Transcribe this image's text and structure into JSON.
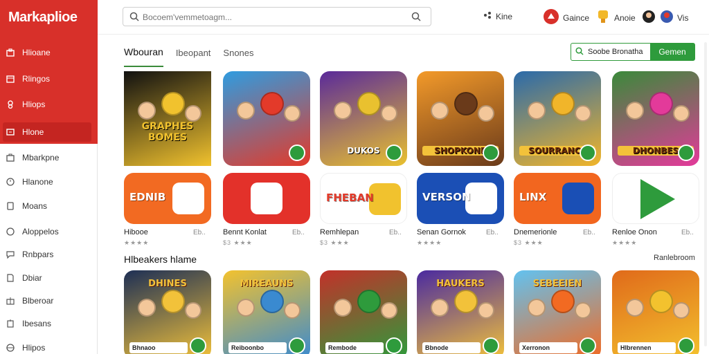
{
  "app": {
    "brand": "Markaplioe"
  },
  "sidebar": {
    "items": [
      {
        "label": "Hlioane",
        "icon": "store-icon"
      },
      {
        "label": "Rlingos",
        "icon": "bag-icon"
      },
      {
        "label": "Hliops",
        "icon": "tag-icon"
      },
      {
        "label": "Hlone",
        "icon": "home-icon"
      },
      {
        "label": "Mbarkpne",
        "icon": "briefcase-icon"
      },
      {
        "label": "Hlanone",
        "icon": "clock-icon"
      },
      {
        "label": "Moans",
        "icon": "tablet-icon"
      },
      {
        "label": "Aloppelos",
        "icon": "circle-icon"
      },
      {
        "label": "Rnbpars",
        "icon": "chat-icon"
      },
      {
        "label": "Dbiar",
        "icon": "doc-icon"
      },
      {
        "label": "Blberoar",
        "icon": "gift-icon"
      },
      {
        "label": "Ibesans",
        "icon": "list-icon"
      },
      {
        "label": "Hlipos",
        "icon": "globe-icon"
      }
    ]
  },
  "topbar": {
    "search_placeholder": "Bocoem'vemmetoagm...",
    "links": [
      {
        "label": "Kine",
        "icon": "share-icon"
      },
      {
        "label": "Gaince",
        "icon": "game-icon"
      },
      {
        "label": "Anoie",
        "icon": "trophy-icon"
      },
      {
        "label": "Vis",
        "icon": "avatar-icon"
      }
    ]
  },
  "tabs": [
    {
      "label": "Wbouran"
    },
    {
      "label": "Ibeopant"
    },
    {
      "label": "Snones"
    }
  ],
  "filter": {
    "label": "Soobe Bronatha",
    "action": "Gemen"
  },
  "row1": [
    {
      "title": "GRAPHES BOMES",
      "name": "Hibooe",
      "value": "Eb..",
      "stars": "★★★★",
      "colors": [
        "#111111",
        "#f1c22e"
      ]
    },
    {
      "title": "",
      "name": "Bennt Konlat",
      "value": "Eb..",
      "stars": "$3 ★★★",
      "colors": [
        "#2f9ce0",
        "#e33a2a"
      ]
    },
    {
      "title": "DUKOS",
      "name": "Remhlepan",
      "value": "Eb..",
      "stars": "$3 ★★★",
      "colors": [
        "#5a2a9a",
        "#e9c12f"
      ]
    },
    {
      "title": "SHOPKONB",
      "name": "Senan Gornok",
      "value": "Eb..",
      "stars": "★★★★",
      "colors": [
        "#f39a2a",
        "#6a3a1a"
      ]
    },
    {
      "title": "SOURRANCE",
      "name": "Dnemerionle",
      "value": "Eb..",
      "stars": "$3 ★★★",
      "colors": [
        "#2a6aaa",
        "#f1b52a"
      ]
    },
    {
      "title": "DHONBES",
      "name": "Renloe Onon",
      "value": "Eb..",
      "stars": "★★★★",
      "colors": [
        "#3a8a3a",
        "#e33a9a"
      ]
    }
  ],
  "row2": [
    {
      "title": "EDNIB",
      "icon": "gamepad-icon",
      "colors": [
        "#f26a22",
        "#ffffff"
      ]
    },
    {
      "title": "",
      "icon": "gamepad-icon",
      "colors": [
        "#e3312a",
        "#ffffff"
      ]
    },
    {
      "title": "FHEBAN",
      "icon": "bubble-icon",
      "colors": [
        "#ffffff",
        "#f1c22e"
      ]
    },
    {
      "title": "VERSON",
      "icon": "ring-icon",
      "colors": [
        "#1b4fb5",
        "#ffffff"
      ]
    },
    {
      "title": "LINX",
      "icon": "box-icon",
      "colors": [
        "#f2661f",
        "#1a4fb5"
      ]
    },
    {
      "title": "",
      "icon": "play-icon",
      "colors": [
        "#ffffff",
        "#2e9b3c"
      ]
    }
  ],
  "section": {
    "title": "Hlbeakers hlame",
    "link": "Ranlebroom"
  },
  "row3": [
    {
      "title": "DHINES",
      "plate": "Bhnaoo",
      "colors": [
        "#1d2f55",
        "#f2c23a"
      ]
    },
    {
      "title": "MIREAUNS",
      "plate": "Reiboonbo",
      "colors": [
        "#f3c22e",
        "#3a8ad0"
      ]
    },
    {
      "title": "",
      "plate": "Rembode",
      "colors": [
        "#c2312a",
        "#2e9b3c"
      ]
    },
    {
      "title": "HAUKERS",
      "plate": "Bbnode",
      "colors": [
        "#4a2aa0",
        "#f2c23a"
      ]
    },
    {
      "title": "SEBEEIEN",
      "plate": "Xerronon",
      "colors": [
        "#62c2f0",
        "#f26a22"
      ]
    },
    {
      "title": "",
      "plate": "Hlbrennen",
      "colors": [
        "#e06a1a",
        "#f3c22e"
      ]
    }
  ]
}
